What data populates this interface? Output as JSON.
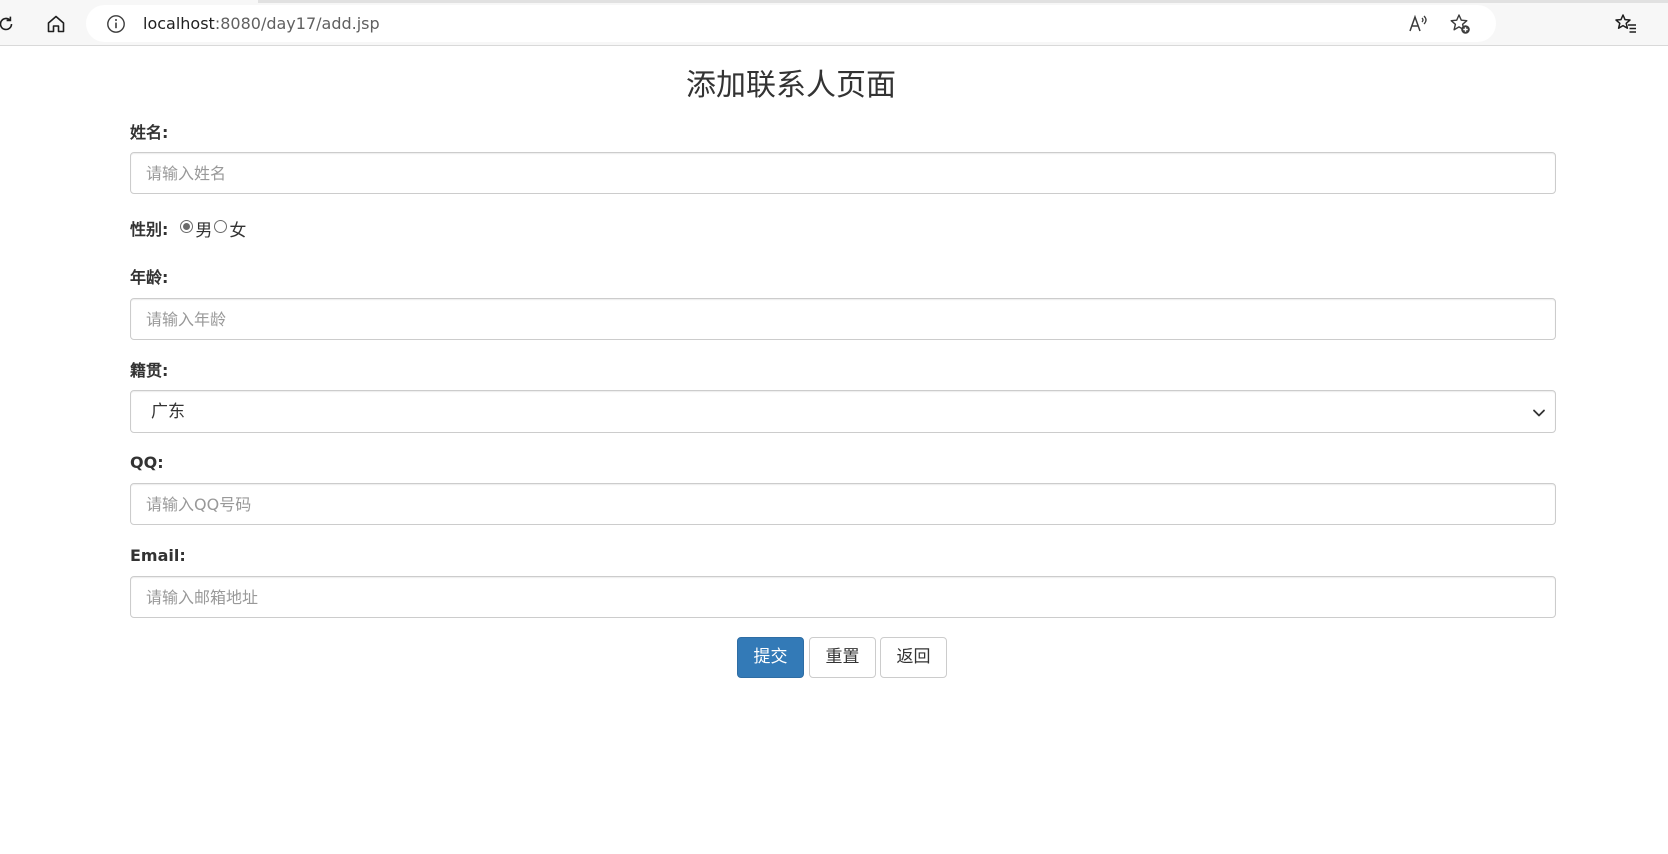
{
  "browser": {
    "url_host": "localhost",
    "url_path": ":8080/day17/add.jsp",
    "icons": {
      "refresh": "refresh-icon",
      "home": "home-icon",
      "info": "info-icon",
      "read_aloud": "read-aloud-icon",
      "add_favorite": "add-favorite-icon",
      "favorites": "favorites-icon"
    }
  },
  "page": {
    "title": "添加联系人页面"
  },
  "form": {
    "name": {
      "label": "姓名:",
      "placeholder": "请输入姓名",
      "value": ""
    },
    "gender": {
      "label": "性别:",
      "options": [
        {
          "label": "男",
          "checked": true
        },
        {
          "label": "女",
          "checked": false
        }
      ]
    },
    "age": {
      "label": "年龄:",
      "placeholder": "请输入年龄",
      "value": ""
    },
    "address": {
      "label": "籍贯:",
      "selected": "广东"
    },
    "qq": {
      "label": "QQ:",
      "placeholder": "请输入QQ号码",
      "value": ""
    },
    "email": {
      "label": "Email:",
      "placeholder": "请输入邮箱地址",
      "value": ""
    },
    "buttons": {
      "submit": "提交",
      "reset": "重置",
      "back": "返回"
    }
  },
  "colors": {
    "primary_button": "#337ab7",
    "input_border": "#cccccc",
    "placeholder_text": "#999999",
    "body_text": "#333333"
  }
}
